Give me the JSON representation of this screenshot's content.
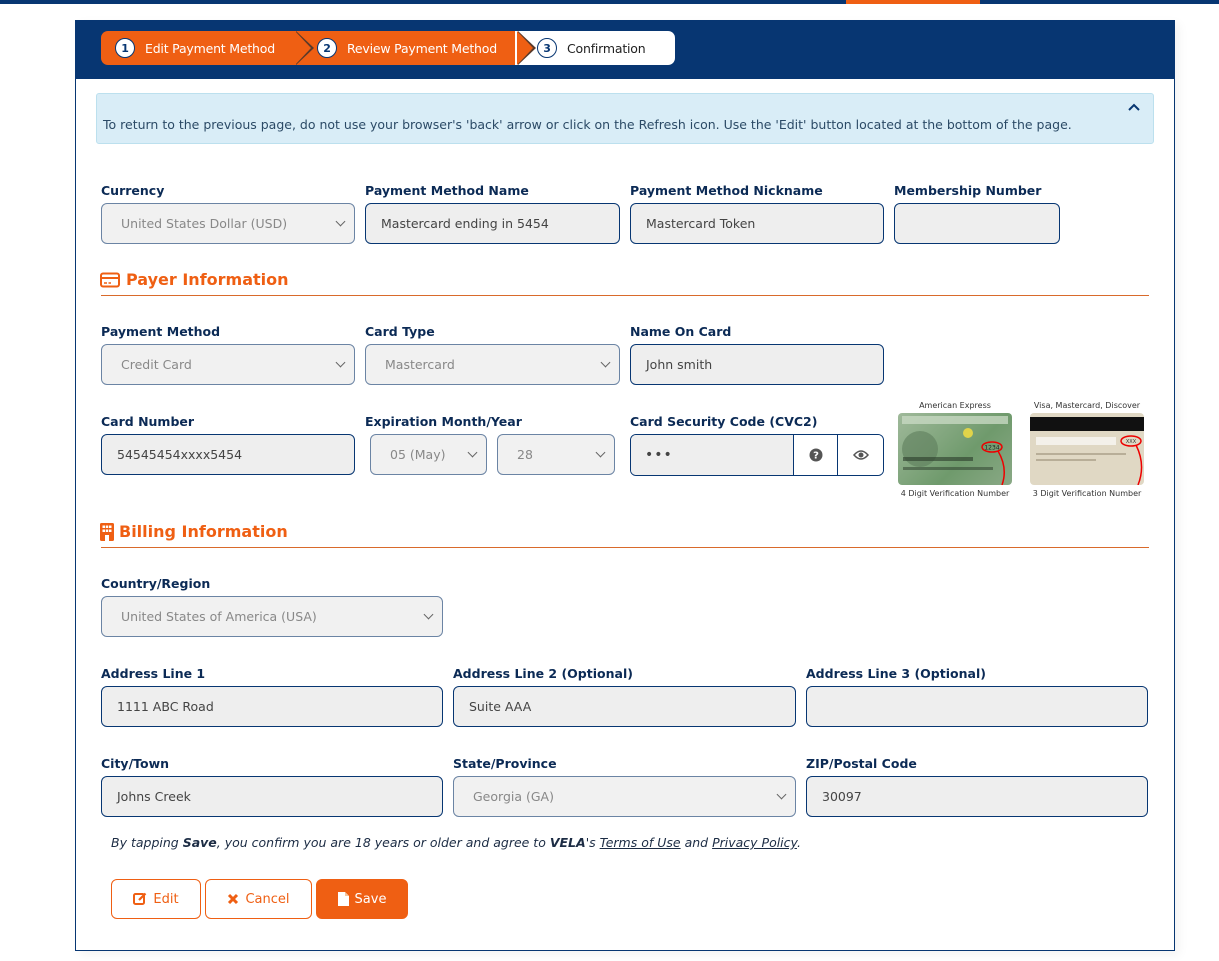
{
  "stepper": {
    "steps": [
      {
        "number": "1",
        "label": "Edit Payment Method",
        "state": "complete"
      },
      {
        "number": "2",
        "label": "Review Payment Method",
        "state": "active"
      },
      {
        "number": "3",
        "label": "Confirmation",
        "state": "pending"
      }
    ]
  },
  "alert": {
    "text": "To return to the previous page, do not use your browser's 'back' arrow or click on the Refresh icon. Use the 'Edit' button located at the bottom of the page.",
    "collapse_icon": "chevron-up-icon"
  },
  "top_fields": {
    "currency": {
      "label": "Currency",
      "value": "United States Dollar (USD)"
    },
    "payment_method_name": {
      "label": "Payment Method Name",
      "value": "Mastercard ending in 5454"
    },
    "payment_method_nickname": {
      "label": "Payment Method Nickname",
      "value": "Mastercard Token"
    },
    "membership_number": {
      "label": "Membership Number",
      "value": ""
    }
  },
  "payer": {
    "title": "Payer Information",
    "icon": "credit-card-icon",
    "payment_method": {
      "label": "Payment Method",
      "value": "Credit Card"
    },
    "card_type": {
      "label": "Card Type",
      "value": "Mastercard"
    },
    "name_on_card": {
      "label": "Name On Card",
      "value": "John smith"
    },
    "card_number": {
      "label": "Card Number",
      "value": "54545454xxxx5454"
    },
    "expiration": {
      "label": "Expiration Month/Year",
      "month": "05 (May)",
      "year": "28"
    },
    "cvc": {
      "label": "Card Security Code (CVC2)",
      "value": "•••",
      "help_icon": "question-circle-icon",
      "show_icon": "eye-icon"
    },
    "card_images": [
      {
        "caption": "American Express",
        "number": "1234",
        "note": "4 Digit Verification Number"
      },
      {
        "caption": "Visa, Mastercard, Discover",
        "number": "XXX",
        "note": "3 Digit Verification Number"
      }
    ]
  },
  "billing": {
    "title": "Billing Information",
    "icon": "building-icon",
    "country": {
      "label": "Country/Region",
      "value": "United States of America (USA)"
    },
    "address1": {
      "label": "Address Line 1",
      "value": "1111 ABC Road"
    },
    "address2": {
      "label": "Address Line 2 (Optional)",
      "value": "Suite AAA"
    },
    "address3": {
      "label": "Address Line 3 (Optional)",
      "value": ""
    },
    "city": {
      "label": "City/Town",
      "value": "Johns Creek"
    },
    "state": {
      "label": "State/Province",
      "value": "Georgia (GA)"
    },
    "zip": {
      "label": "ZIP/Postal Code",
      "value": "30097"
    }
  },
  "consent": {
    "prefix": "By tapping ",
    "save_word": "Save",
    "middle": ", you confirm you are 18 years or older and agree to ",
    "brand": "VELA",
    "possessive": "'s ",
    "terms_link": "Terms of Use",
    "and": " and ",
    "privacy_link": "Privacy Policy",
    "suffix": "."
  },
  "actions": {
    "edit_label": "Edit",
    "cancel_label": "Cancel",
    "save_label": "Save"
  },
  "colors": {
    "brand_navy": "#073672",
    "brand_orange": "#ef5f13",
    "alert_bg": "#d9edf7",
    "input_bg": "#eeeeee"
  }
}
